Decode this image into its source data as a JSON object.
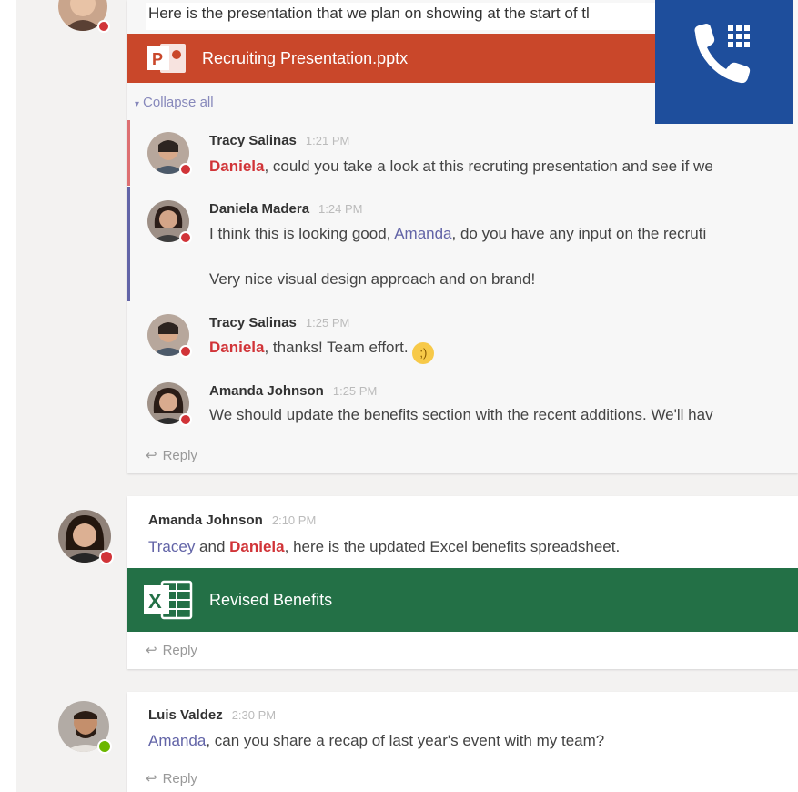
{
  "thread1": {
    "intro_text": "Here is the presentation that we plan on showing at the start of tl",
    "attachment_name": "Recruiting Presentation.pptx",
    "attachment_color": "#c9472a",
    "collapse_label": "Collapse all",
    "replies": [
      {
        "author": "Tracy Salinas",
        "time": "1:21 PM",
        "mention": "Daniela",
        "text": ", could you take a look at this recruting presentation and see if we",
        "status": "busy"
      },
      {
        "author": "Daniela Madera",
        "time": "1:24 PM",
        "pre": "I think this is looking good, ",
        "mention": "Amanda",
        "text": ", do you have any input on the recruti",
        "text2": "Very nice visual design approach and on brand!",
        "status": "busy"
      },
      {
        "author": "Tracy Salinas",
        "time": "1:25 PM",
        "mention": "Daniela",
        "text": ", thanks! Team effort.",
        "emoji": "😉",
        "status": "busy"
      },
      {
        "author": "Amanda Johnson",
        "time": "1:25 PM",
        "text": "We should update the benefits section with the recent additions. We'll hav",
        "status": "busy"
      }
    ],
    "reply_label": "Reply"
  },
  "thread2": {
    "author": "Amanda Johnson",
    "time": "2:10 PM",
    "mention_blue": "Tracey",
    "and": " and ",
    "mention_red": "Daniela",
    "text": ", here is the updated Excel benefits spreadsheet.",
    "attachment_name": "Revised Benefits",
    "attachment_color": "#237046",
    "reply_label": "Reply",
    "status": "busy"
  },
  "thread3": {
    "author": "Luis Valdez",
    "time": "2:30 PM",
    "mention_blue": "Amanda",
    "text": ", can you share a recap of last year's event with my team?",
    "reply_label": "Reply",
    "status": "available"
  },
  "call_tile": {
    "icon": "phone-keypad-icon",
    "color": "#1e4e9c"
  },
  "colors": {
    "busy": "#d13438",
    "available": "#6bb700",
    "accent": "#6264a7"
  }
}
